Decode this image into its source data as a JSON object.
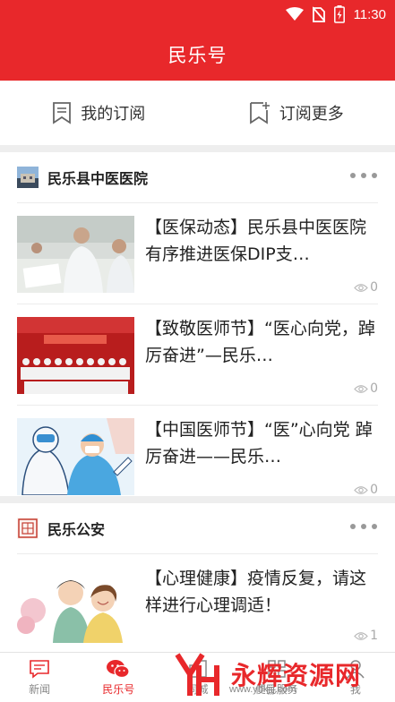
{
  "status_bar": {
    "time": "11:30"
  },
  "header": {
    "title": "民乐号"
  },
  "subscriptions": {
    "mine_label": "我的订阅",
    "more_label": "订阅更多"
  },
  "feeds": [
    {
      "source": "民乐县中医医院",
      "items": [
        {
          "title": "【医保动态】民乐县中医医院有序推进医保DIP支…",
          "views": "0"
        },
        {
          "title": "【致敬医师节】“医心向党，踔厉奋进”—民乐…",
          "views": "0"
        },
        {
          "title": "【中国医师节】“医”心向党  踔厉奋进——民乐…",
          "views": "0"
        }
      ]
    },
    {
      "source": "民乐公安",
      "items": [
        {
          "title": "【心理健康】疫情反复，请这样进行心理调适！",
          "views": "1"
        }
      ]
    }
  ],
  "bottom_nav": {
    "items": [
      {
        "label": "新闻",
        "icon": "news-icon"
      },
      {
        "label": "民乐号",
        "icon": "wechat-icon"
      },
      {
        "label": "同城",
        "icon": "city-icon"
      },
      {
        "label": "便民服务",
        "icon": "service-icon"
      },
      {
        "label": "我",
        "icon": "user-icon"
      }
    ]
  },
  "watermark": {
    "brand": "永辉资源网",
    "url": "www.yhkjjj.com"
  },
  "colors": {
    "accent": "#e8282b"
  }
}
